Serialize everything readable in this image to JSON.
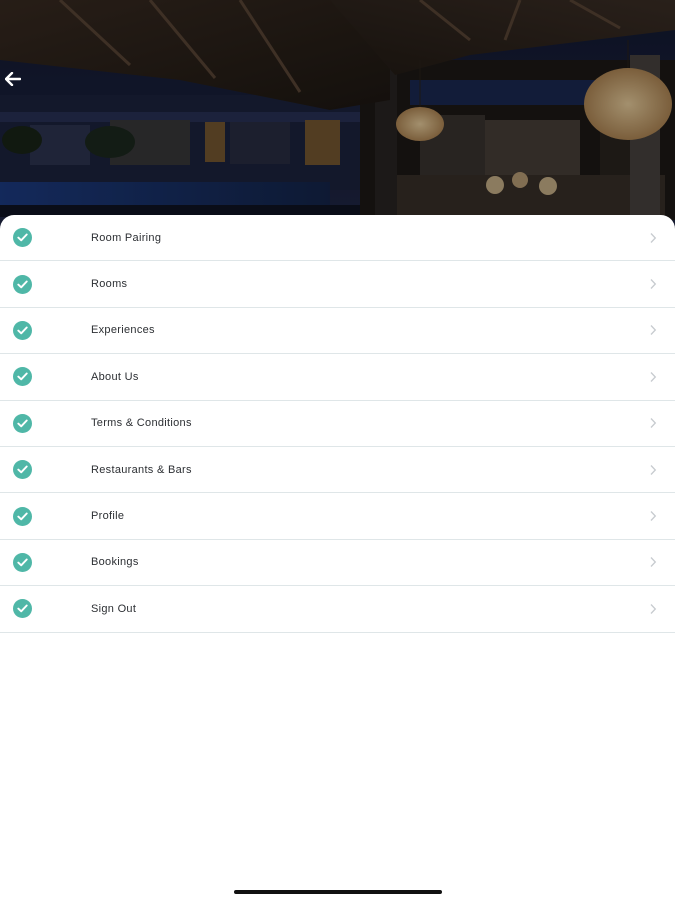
{
  "menu": {
    "items": [
      {
        "label": "Room Pairing",
        "icon": "check-circle-icon"
      },
      {
        "label": "Rooms",
        "icon": "check-circle-icon"
      },
      {
        "label": "Experiences",
        "icon": "check-circle-icon"
      },
      {
        "label": "About Us",
        "icon": "check-circle-icon"
      },
      {
        "label": "Terms & Conditions",
        "icon": "check-circle-icon"
      },
      {
        "label": "Restaurants & Bars",
        "icon": "check-circle-icon"
      },
      {
        "label": "Profile",
        "icon": "check-circle-icon"
      },
      {
        "label": "Bookings",
        "icon": "check-circle-icon"
      },
      {
        "label": "Sign Out",
        "icon": "check-circle-icon"
      }
    ]
  },
  "header": {
    "back_icon": "back-arrow-icon"
  },
  "colors": {
    "accent": "#4fb7a7",
    "divider": "#dfe6e8",
    "label_text": "#2c2f33",
    "chevron": "#c7cbcf"
  }
}
